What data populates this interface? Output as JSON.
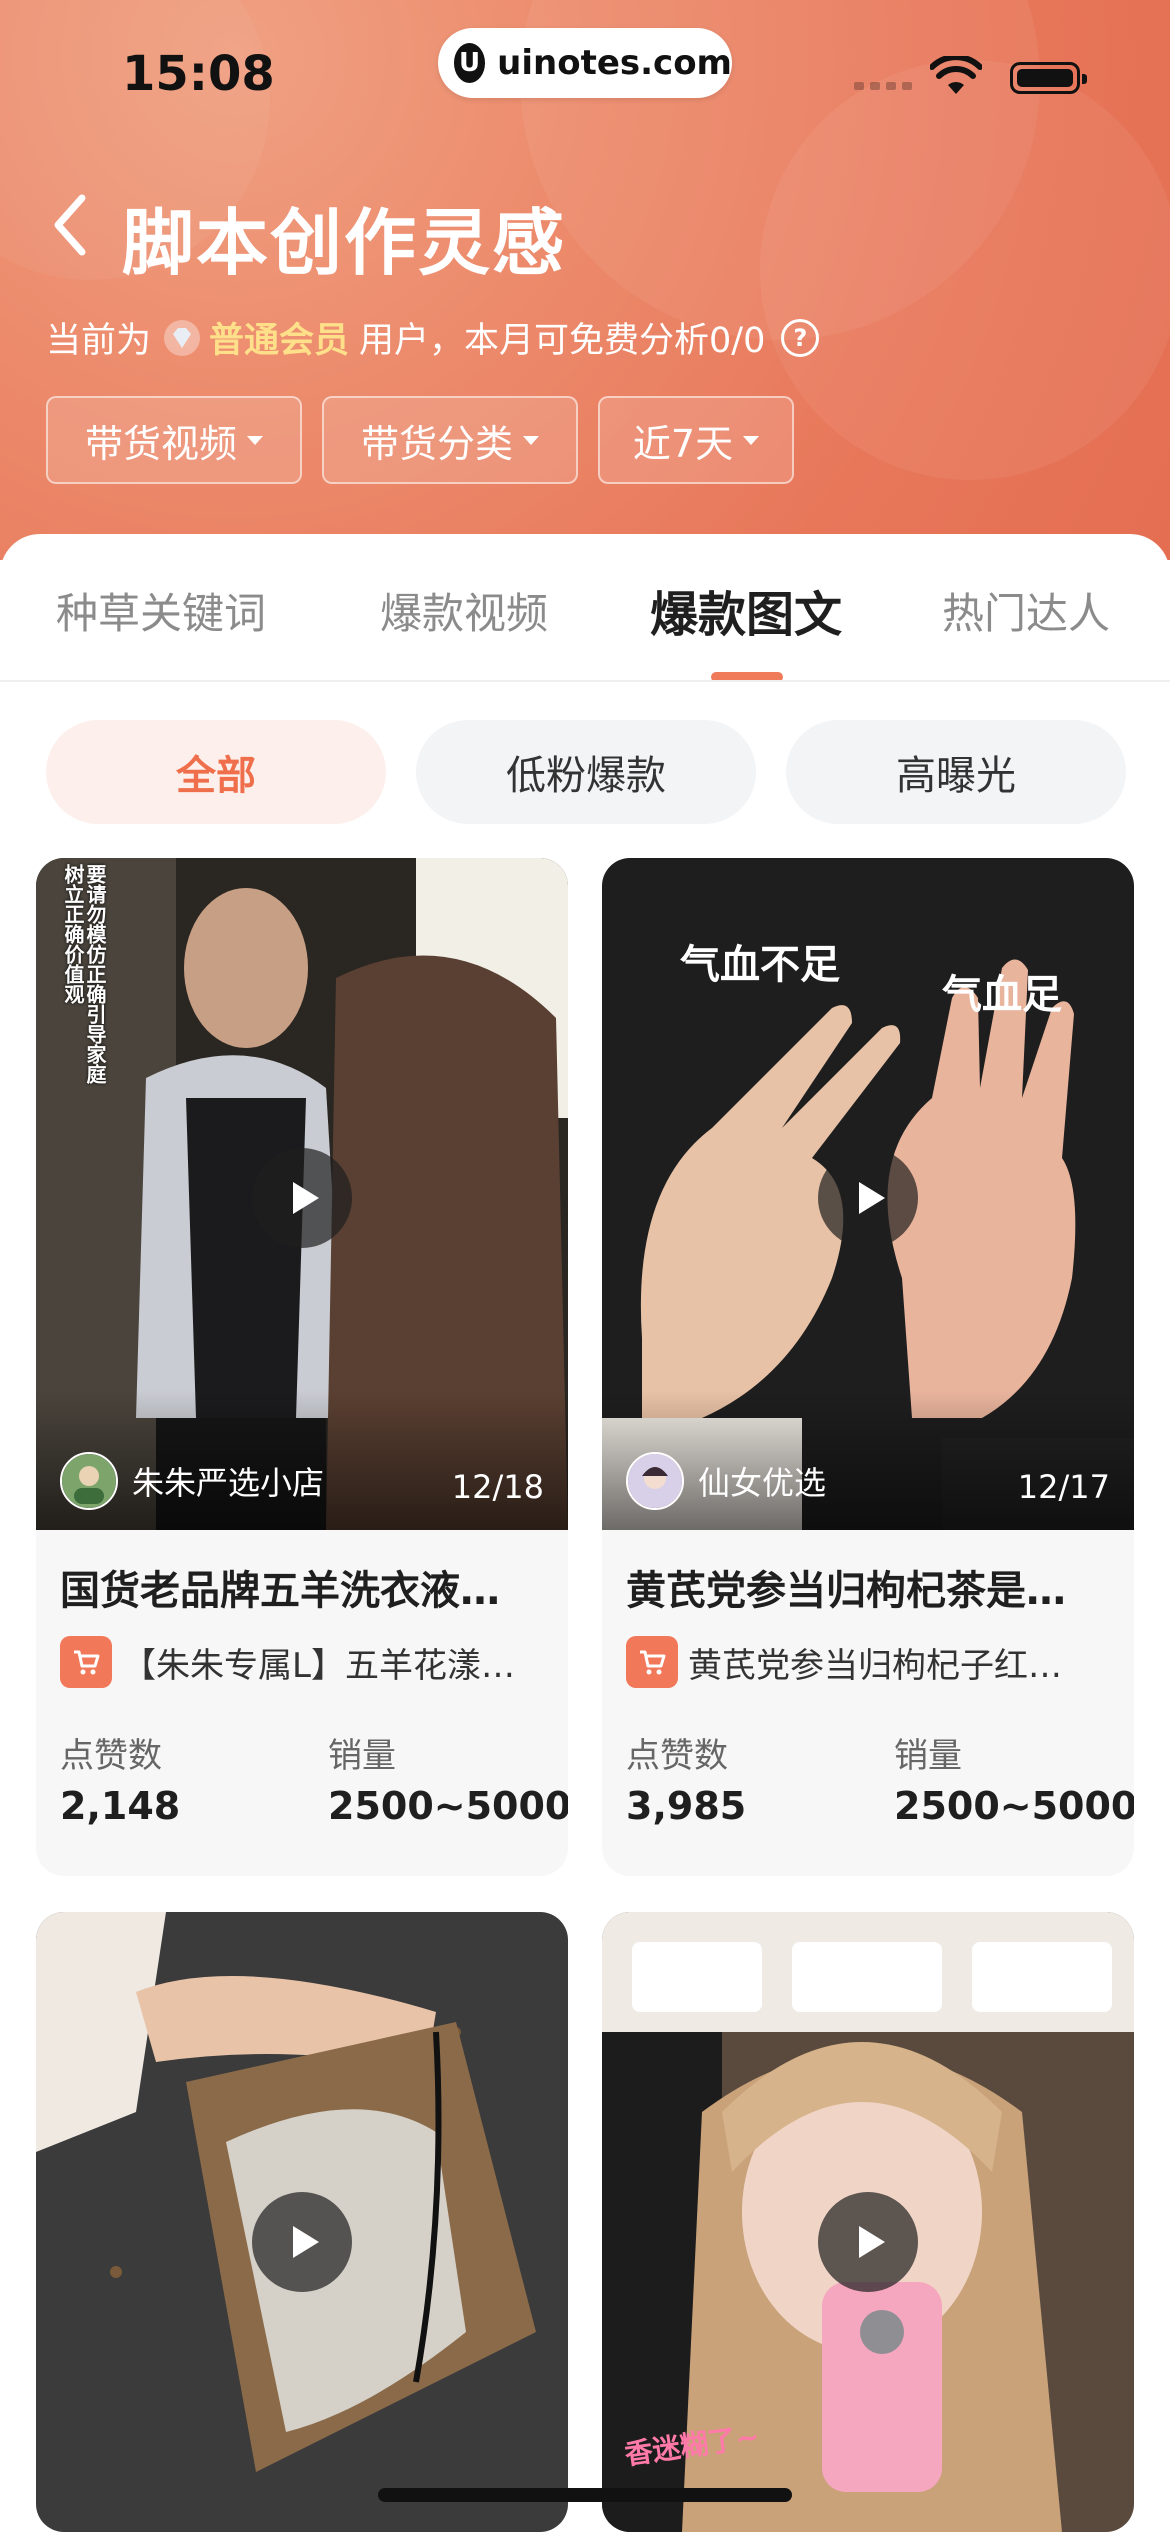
{
  "status_bar": {
    "time": "15:08",
    "url": "uinotes.com",
    "url_logo": "U"
  },
  "header": {
    "title": "脚本创作灵感",
    "member_prefix": "当前为",
    "member_level": "普通会员",
    "member_suffix": "用户，本月可免费分析0/0",
    "help_glyph": "?",
    "filters": [
      "带货视频",
      "带货分类",
      "近7天"
    ]
  },
  "tabs": [
    "种草关键词",
    "爆款视频",
    "爆款图文",
    "热门达人"
  ],
  "active_tab": "爆款图文",
  "chips": [
    "全部",
    "低粉爆款",
    "高曝光"
  ],
  "active_chip": "全部",
  "cards": [
    {
      "author": "朱朱严选小店",
      "date": "12/18",
      "title": "国货老品牌五羊洗衣液…",
      "goods": "【朱朱专属L】五羊花漾…",
      "likes_label": "点赞数",
      "likes": "2,148",
      "sales_label": "销量",
      "sales": "2500~5000",
      "overlay_text": "要请勿模仿正确引导家庭树立正确价值观"
    },
    {
      "author": "仙女优选",
      "date": "12/17",
      "title": "黄芪党参当归枸杞茶是…",
      "goods": "黄芪党参当归枸杞子红…",
      "likes_label": "点赞数",
      "likes": "3,985",
      "sales_label": "销量",
      "sales": "2500~5000",
      "overlay_left": "气血不足",
      "overlay_right": "气血足"
    },
    {
      "overlay_text": ""
    },
    {
      "overlay_text": "香迷糊了~"
    }
  ],
  "colors": {
    "header_start": "#f0a082",
    "header_end": "#e46e52",
    "accent": "#ef6f4c",
    "member_level": "#ffe08a",
    "cart_badge": "#f2785a"
  }
}
